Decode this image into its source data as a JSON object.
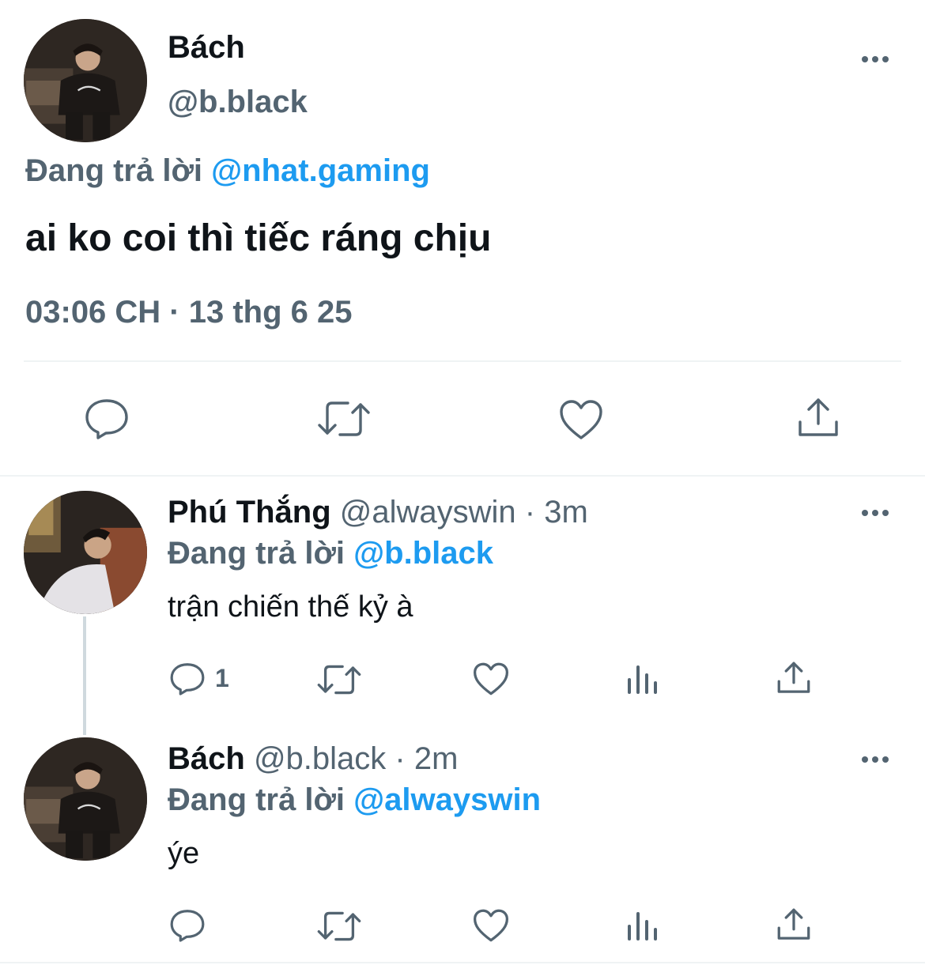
{
  "main_tweet": {
    "name": "Bách",
    "handle": "@b.black",
    "reply_prefix": "Đang trả lời",
    "reply_to": "@nhat.gaming",
    "text": "ai ko coi thì tiếc ráng chịu",
    "timestamp": "03:06 CH · 13 thg 6 25",
    "actions": [
      "reply-icon",
      "retweet-icon",
      "like-icon",
      "share-icon"
    ]
  },
  "replies": [
    {
      "name": "Phú Thắng",
      "handle": "@alwayswin",
      "time": "· 3m",
      "reply_prefix": "Đang trả lời",
      "reply_to": "@b.black",
      "text": "trận chiến thế kỷ à",
      "reply_count": "1",
      "actions": [
        "reply-icon",
        "retweet-icon",
        "like-icon",
        "views-icon",
        "share-icon"
      ]
    },
    {
      "name": "Bách",
      "handle": "@b.black",
      "time": "· 2m",
      "reply_prefix": "Đang trả lời",
      "reply_to": "@alwayswin",
      "text": "ýe",
      "reply_count": "",
      "actions": [
        "reply-icon",
        "retweet-icon",
        "like-icon",
        "views-icon",
        "share-icon"
      ]
    }
  ],
  "colors": {
    "text": "#0f1419",
    "secondary": "#536471",
    "link": "#1d9bf0",
    "divider": "#eff3f4"
  }
}
